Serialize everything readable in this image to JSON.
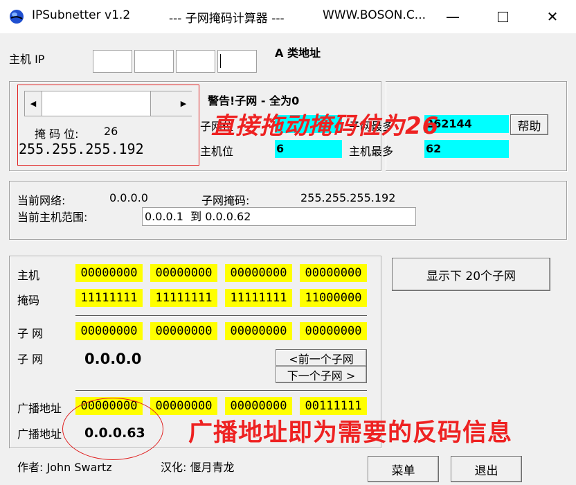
{
  "window": {
    "app_title": "IPSubnetter v1.2",
    "center_title": "--- 子网掩码计算器 ---",
    "site_title": "WWW.BOSON.C...",
    "minimize_icon": "minimize-icon",
    "maximize_icon": "maximize-icon",
    "close_icon": "close-icon"
  },
  "host_ip": {
    "label": "主机 IP",
    "octets": [
      "",
      "",
      "",
      ""
    ],
    "class_label": "A 类地址"
  },
  "mask_group": {
    "mask_bits_label": "掩 码 位:",
    "mask_bits_value": "26",
    "mask_value": "255.255.255.192",
    "slider_left_icon": "triangle-left-icon",
    "slider_right_icon": "triangle-right-icon"
  },
  "info": {
    "warning": "警告!子网 - 全为0",
    "subnet_bits_label": "子网位",
    "subnet_bits_value": "",
    "max_subnets_label": "子网最多",
    "max_subnets_value": "262144",
    "host_bits_label": "主机位",
    "host_bits_value": "6",
    "max_hosts_label": "主机最多",
    "max_hosts_value": "62",
    "help_button": "帮助"
  },
  "current": {
    "network_label": "当前网络:",
    "network_value": "0.0.0.0",
    "subnet_mask_label": "子网掩码:",
    "subnet_mask_value": "255.255.255.192",
    "host_range_label": "当前主机范围:",
    "host_range_value": "0.0.0.1  到 0.0.0.62"
  },
  "binary": {
    "host_label": "主机",
    "host_bits": [
      "00000000",
      "00000000",
      "00000000",
      "00000000"
    ],
    "mask_label": "掩码",
    "mask_bits": [
      "11111111",
      "11111111",
      "11111111",
      "11000000"
    ],
    "subnet_label": "子 网",
    "subnet_bits": [
      "00000000",
      "00000000",
      "00000000",
      "00000000"
    ],
    "subnet_label2": "子 网",
    "subnet_value": "0.0.0.0",
    "prev_subnet_button": "<前一个子网",
    "next_subnet_button": "下一个子网 >",
    "broadcast_label": "广播地址",
    "broadcast_bits": [
      "00000000",
      "00000000",
      "00000000",
      "00111111"
    ],
    "broadcast_label2": "广播地址",
    "broadcast_value": "0.0.0.63"
  },
  "right_panel": {
    "show_subnets_button": "显示下 20个子网"
  },
  "footer": {
    "author": "作者: John Swartz",
    "translator": "汉化: 偃月青龙",
    "menu_button": "菜单",
    "exit_button": "退出"
  },
  "annotations": {
    "drag_note": "直接拖动掩码位为26",
    "broadcast_note": "广播地址即为需要的反码信息",
    "annotation_color": "#ee2222"
  }
}
